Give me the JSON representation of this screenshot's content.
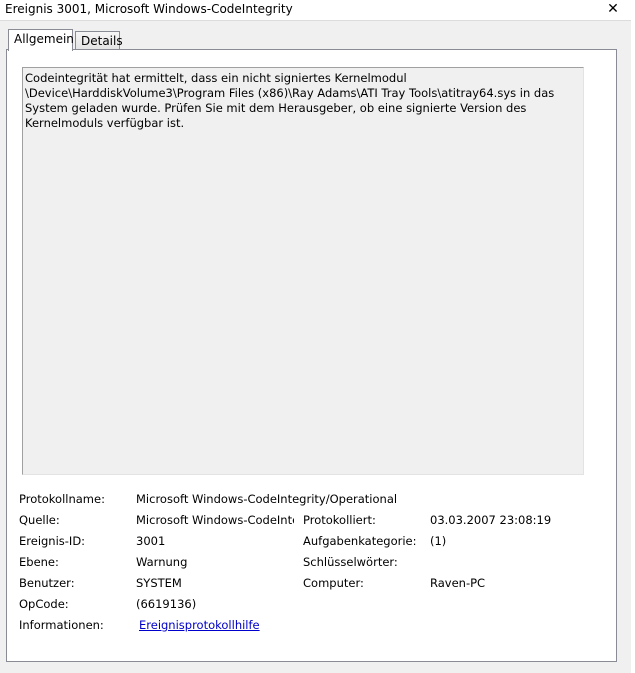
{
  "window": {
    "title": "Ereignis 3001, Microsoft Windows-CodeIntegrity",
    "close_symbol": "✕"
  },
  "tabs": [
    {
      "label": "Allgemein",
      "selected": true
    },
    {
      "label": "Details",
      "selected": false
    }
  ],
  "description": "Codeintegrität hat ermittelt, dass ein nicht signiertes Kernelmodul \\Device\\HarddiskVolume3\\Program Files (x86)\\Ray Adams\\ATI Tray Tools\\atitray64.sys in das System geladen wurde. Prüfen Sie mit dem Herausgeber, ob eine signierte Version des Kernelmoduls verfügbar ist.",
  "fields": {
    "protokollname": {
      "label": "Protokollname:",
      "value": "Microsoft Windows-CodeIntegrity/Operational"
    },
    "quelle": {
      "label": "Quelle:",
      "value": "Microsoft Windows-CodeInte"
    },
    "protokolliert": {
      "label": "Protokolliert:",
      "value": "03.03.2007 23:08:19"
    },
    "ereignis_id": {
      "label": "Ereignis-ID:",
      "value": "3001"
    },
    "aufgabenkategorie": {
      "label": "Aufgabenkategorie:",
      "value": "(1)"
    },
    "ebene": {
      "label": "Ebene:",
      "value": "Warnung"
    },
    "schluesselwoerter": {
      "label": "Schlüsselwörter:",
      "value": ""
    },
    "benutzer": {
      "label": "Benutzer:",
      "value": "SYSTEM"
    },
    "computer": {
      "label": "Computer:",
      "value": "Raven-PC"
    },
    "opcode": {
      "label": "OpCode:",
      "value": "(6619136)"
    },
    "informationen": {
      "label": "Informationen:",
      "link": "Ereignisprotokollhilfe"
    }
  },
  "colors": {
    "link": "#0000cc",
    "panel_bg": "#f0f0f0",
    "tab_border": "#898c95"
  }
}
